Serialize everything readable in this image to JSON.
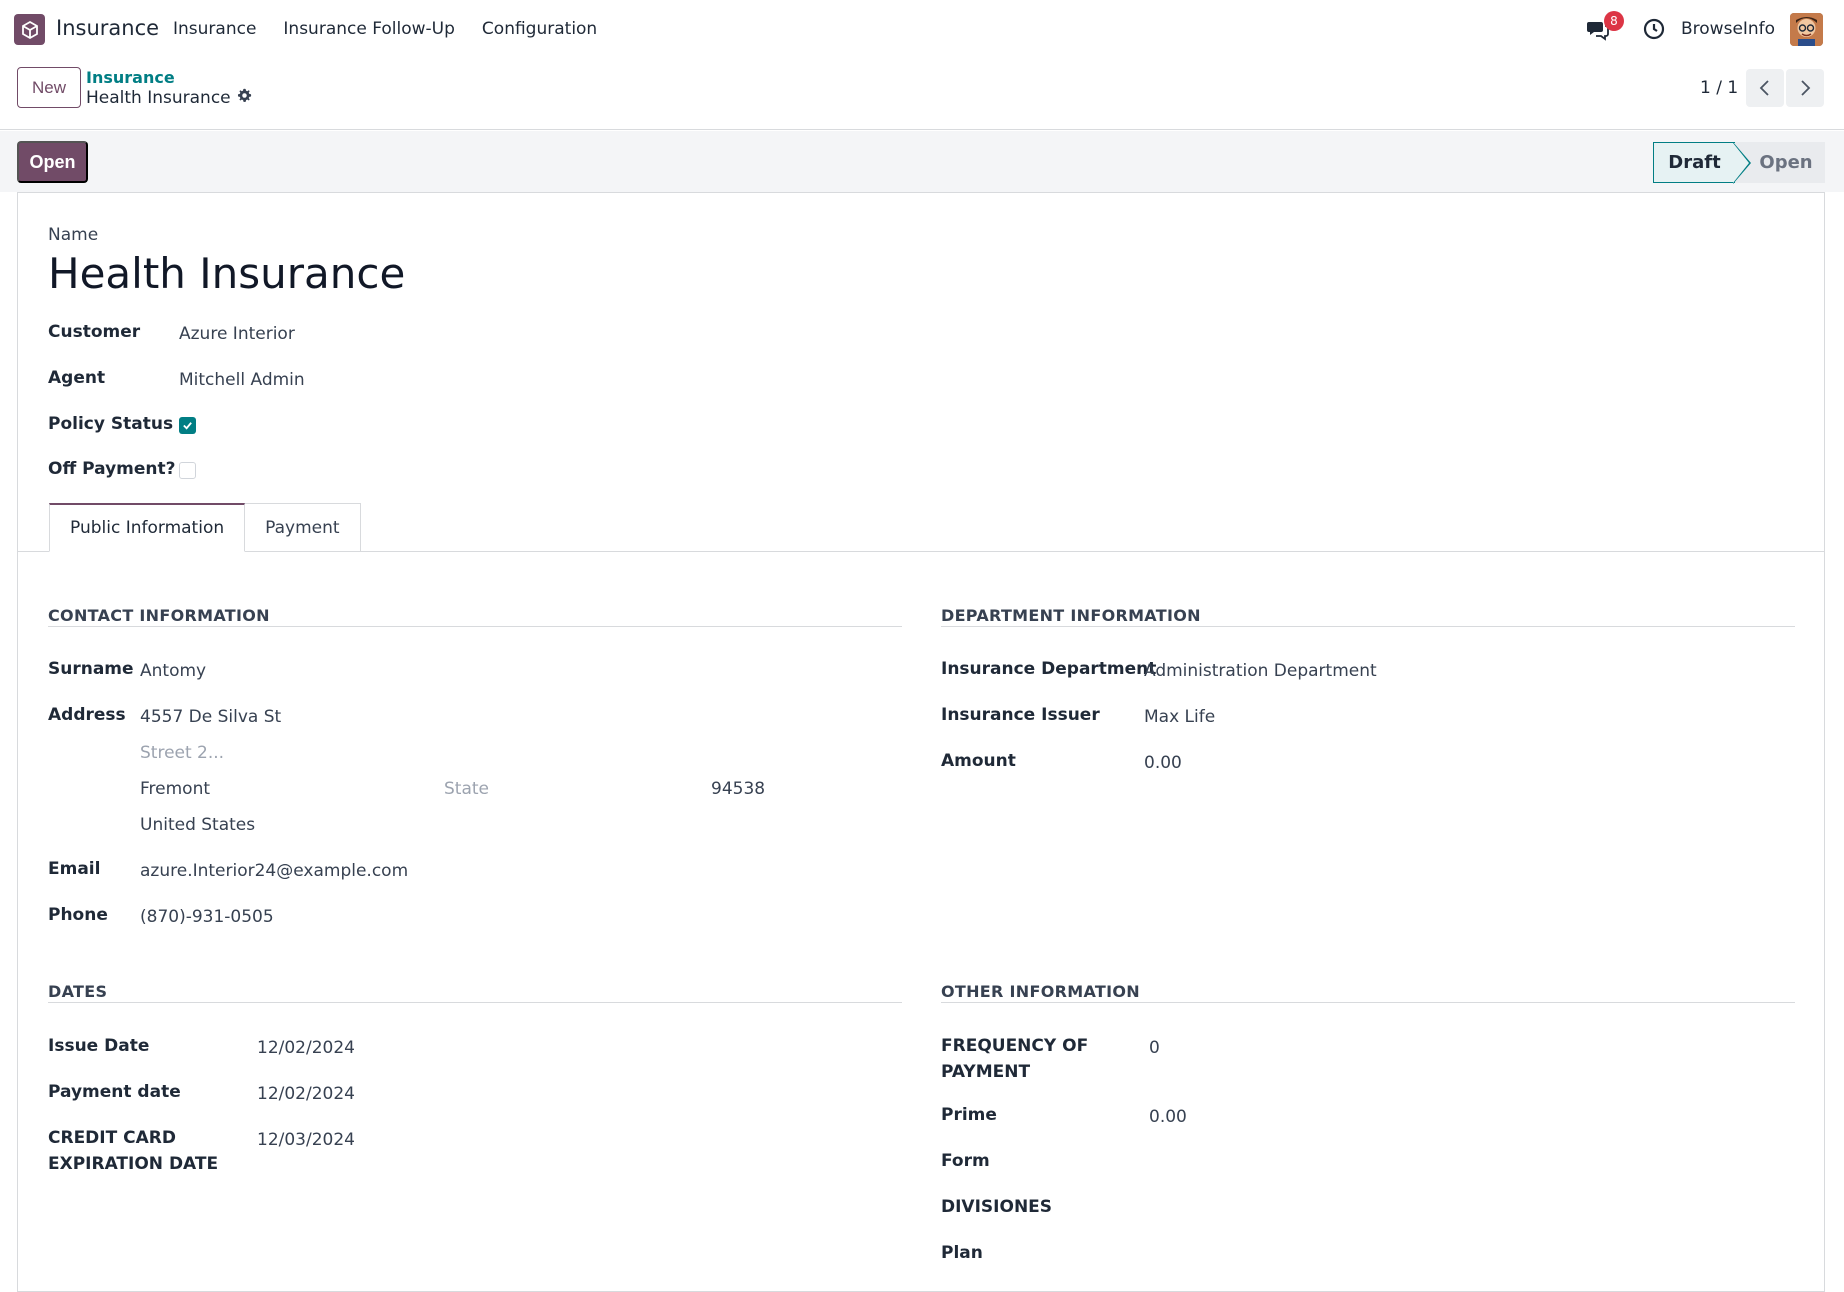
{
  "navbar": {
    "app_name": "Insurance",
    "menu": [
      "Insurance",
      "Insurance Follow-Up",
      "Configuration"
    ],
    "chat_count": "8",
    "company": "BrowseInfo",
    "icons": {
      "chat": "chat-icon",
      "clock": "clock-icon",
      "logo": "app-logo-icon"
    }
  },
  "control": {
    "new_label": "New",
    "breadcrumb_parent": "Insurance",
    "breadcrumb_current": "Health Insurance",
    "pager": "1 / 1"
  },
  "statusbar": {
    "open_label": "Open",
    "stages": [
      "Draft",
      "Open"
    ],
    "active_stage": "Draft"
  },
  "form": {
    "name_label": "Name",
    "name_value": "Health Insurance",
    "customer_label": "Customer",
    "customer_value": "Azure Interior",
    "agent_label": "Agent",
    "agent_value": "Mitchell Admin",
    "policy_status_label": "Policy Status",
    "policy_status_checked": true,
    "off_payment_label": "Off Payment?",
    "off_payment_checked": false
  },
  "tabs": [
    "Public Information",
    "Payment"
  ],
  "contact": {
    "title": "CONTACT INFORMATION",
    "surname_label": "Surname",
    "surname_value": "Antomy",
    "address_label": "Address",
    "street": "4557 De Silva St",
    "street2_placeholder": "Street 2...",
    "city": "Fremont",
    "state_placeholder": "State",
    "zip": "94538",
    "country": "United States",
    "email_label": "Email",
    "email_value": "azure.Interior24@example.com",
    "phone_label": "Phone",
    "phone_value": "(870)-931-0505"
  },
  "department": {
    "title": "DEPARTMENT INFORMATION",
    "dept_label": "Insurance Department",
    "dept_value": "Administration Department",
    "issuer_label": "Insurance Issuer",
    "issuer_value": "Max Life",
    "amount_label": "Amount",
    "amount_value": "0.00"
  },
  "dates": {
    "title": "DATES",
    "issue_label": "Issue Date",
    "issue_value": "12/02/2024",
    "payment_label": "Payment date",
    "payment_value": "12/02/2024",
    "cc_label_1": "CREDIT CARD",
    "cc_label_2": "EXPIRATION DATE",
    "cc_value": "12/03/2024"
  },
  "other": {
    "title": "OTHER INFORMATION",
    "freq_label_1": "FREQUENCY OF",
    "freq_label_2": "PAYMENT",
    "freq_value": "0",
    "prime_label": "Prime",
    "prime_value": "0.00",
    "form_label": "Form",
    "divisiones_label": "DIVISIONES",
    "plan_label": "Plan"
  },
  "colors": {
    "primary": "#714b67",
    "accent": "#017e84",
    "badge": "#dc3545"
  }
}
